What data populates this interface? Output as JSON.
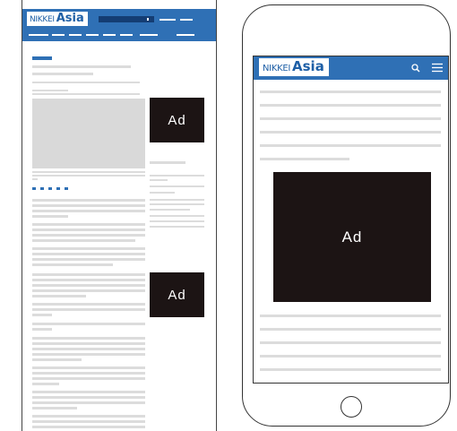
{
  "brand": {
    "name_light": "NIKKEI",
    "name_bold": "Asia"
  },
  "desktop": {
    "ad_top": "Ad",
    "ad_bottom": "Ad"
  },
  "mobile": {
    "ad": "Ad",
    "search_icon": "search-icon",
    "menu_icon": "hamburger-menu-icon"
  },
  "colors": {
    "brand_blue": "#2f70b5",
    "ad_black": "#1c1414",
    "placeholder_gray": "#dcdcdc"
  }
}
